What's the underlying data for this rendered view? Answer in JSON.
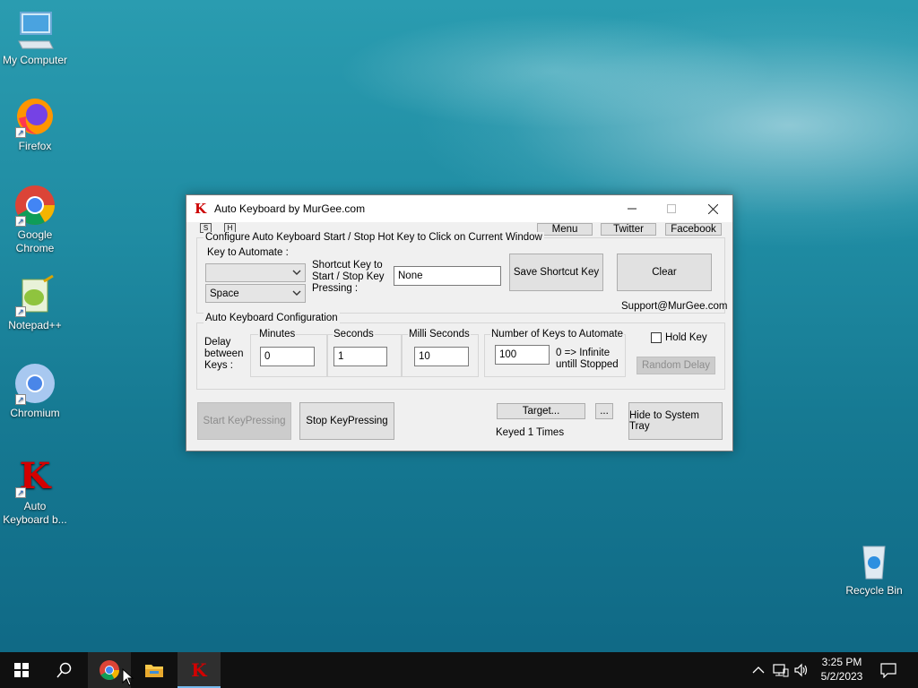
{
  "desktop": {
    "icons": [
      {
        "label": "My Computer"
      },
      {
        "label": "Firefox"
      },
      {
        "label": "Google Chrome"
      },
      {
        "label": "Notepad++"
      },
      {
        "label": "Chromium"
      },
      {
        "label": "Auto Keyboard b..."
      },
      {
        "label": "Recycle Bin"
      }
    ]
  },
  "window": {
    "title": "Auto Keyboard by MurGee.com",
    "app_icon_letter": "K",
    "small_buttons": [
      "S",
      "H"
    ],
    "top_buttons": {
      "menu": "Menu",
      "twitter": "Twitter",
      "facebook": "Facebook"
    },
    "hotkey_group": {
      "title": "Configure Auto Keyboard Start / Stop Hot Key to Click on Current Window",
      "key_to_automate_label": "Key to Automate :",
      "key_select_1_value": "",
      "key_select_2_value": "Space",
      "shortcut_label": "Shortcut Key to Start / Stop Key Pressing :",
      "shortcut_value": "None",
      "save_shortcut_label": "Save Shortcut Key",
      "clear_label": "Clear",
      "support_email": "Support@MurGee.com"
    },
    "config_group": {
      "title": "Auto Keyboard Configuration",
      "delay_label": "Delay between Keys :",
      "minutes_label": "Minutes",
      "minutes_value": "0",
      "seconds_label": "Seconds",
      "seconds_value": "1",
      "milli_label": "Milli Seconds",
      "milli_value": "10",
      "num_keys_label": "Number of Keys to Automate",
      "num_keys_value": "100",
      "infinite_note": "0 => Infinite untill Stopped",
      "hold_key_label": "Hold Key",
      "hold_key_checked": false,
      "random_delay_label": "Random Delay"
    },
    "actions": {
      "start_label": "Start KeyPressing",
      "stop_label": "Stop KeyPressing",
      "target_label": "Target...",
      "more_label": "...",
      "keyed_status": "Keyed 1 Times",
      "hide_label": "Hide to System Tray"
    }
  },
  "taskbar": {
    "time": "3:25 PM",
    "date": "5/2/2023"
  }
}
